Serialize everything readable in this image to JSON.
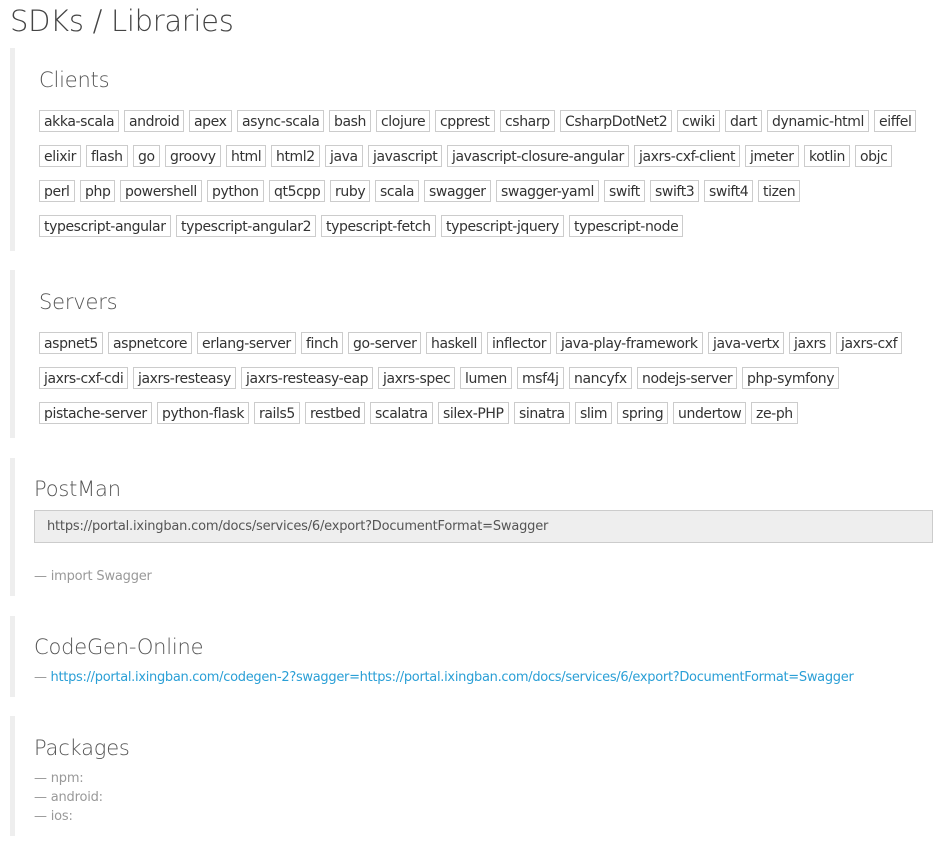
{
  "page_title": "SDKs / Libraries",
  "clients": {
    "title": "Clients",
    "rows": [
      [
        "akka-scala",
        "android",
        "apex",
        "async-scala",
        "bash",
        "clojure",
        "cpprest",
        "csharp",
        "CsharpDotNet2",
        "cwiki",
        "dart",
        "dynamic-html",
        "eiffel"
      ],
      [
        "elixir",
        "flash",
        "go",
        "groovy",
        "html",
        "html2",
        "java",
        "javascript",
        "javascript-closure-angular",
        "jaxrs-cxf-client",
        "jmeter",
        "kotlin",
        "objc"
      ],
      [
        "perl",
        "php",
        "powershell",
        "python",
        "qt5cpp",
        "ruby",
        "scala",
        "swagger",
        "swagger-yaml",
        "swift",
        "swift3",
        "swift4",
        "tizen"
      ],
      [
        "typescript-angular",
        "typescript-angular2",
        "typescript-fetch",
        "typescript-jquery",
        "typescript-node"
      ]
    ]
  },
  "servers": {
    "title": "Servers",
    "rows": [
      [
        "aspnet5",
        "aspnetcore",
        "erlang-server",
        "finch",
        "go-server",
        "haskell",
        "inflector",
        "java-play-framework",
        "java-vertx",
        "jaxrs",
        "jaxrs-cxf"
      ],
      [
        "jaxrs-cxf-cdi",
        "jaxrs-resteasy",
        "jaxrs-resteasy-eap",
        "jaxrs-spec",
        "lumen",
        "msf4j",
        "nancyfx",
        "nodejs-server",
        "php-symfony"
      ],
      [
        "pistache-server",
        "python-flask",
        "rails5",
        "restbed",
        "scalatra",
        "silex-PHP",
        "sinatra",
        "slim",
        "spring",
        "undertow",
        "ze-ph"
      ]
    ]
  },
  "postman": {
    "title": "PostMan",
    "url": "https://portal.ixingban.com/docs/services/6/export?DocumentFormat=Swagger",
    "note": "— import Swagger"
  },
  "codegen": {
    "title": "CodeGen-Online",
    "dash": "— ",
    "link": "https://portal.ixingban.com/codegen-2?swagger=https://portal.ixingban.com/docs/services/6/export?DocumentFormat=Swagger"
  },
  "packages": {
    "title": "Packages",
    "items": [
      "— npm:",
      "— android:",
      "— ios:"
    ]
  }
}
